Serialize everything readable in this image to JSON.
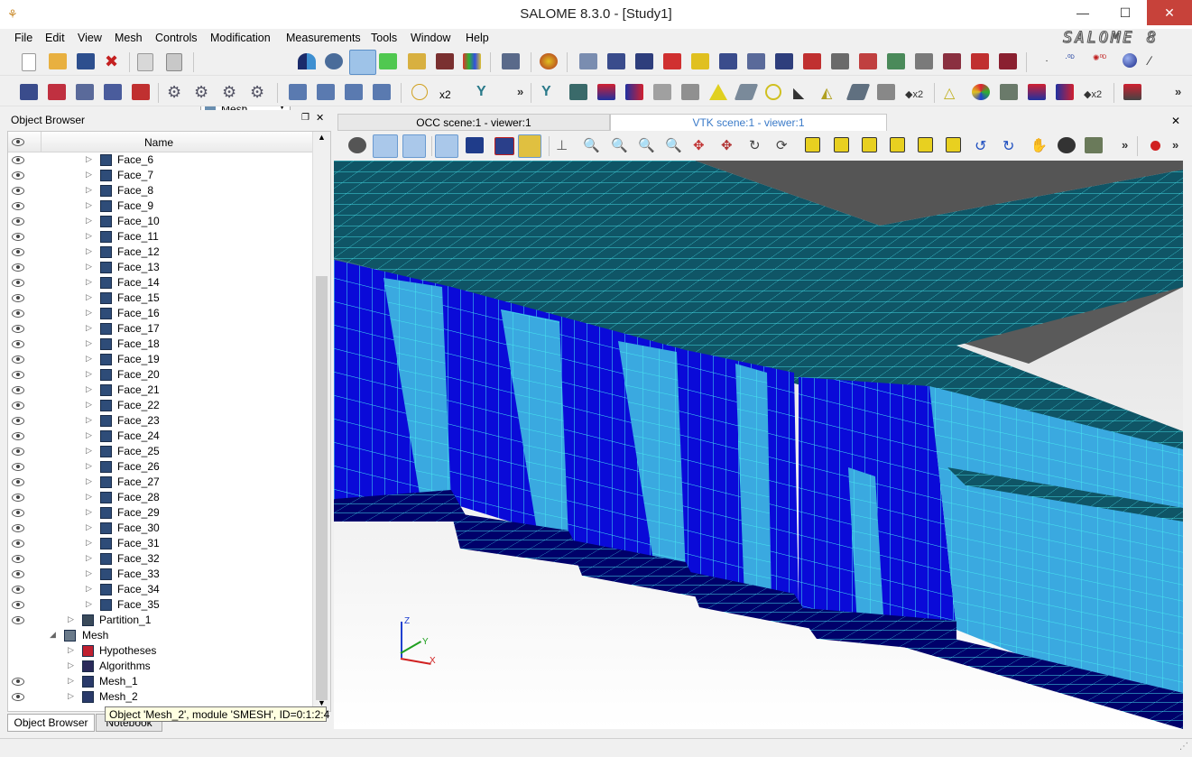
{
  "window": {
    "title": "SALOME 8.3.0 - [Study1]",
    "minimize": "—",
    "maximize": "☐",
    "close": "✕"
  },
  "menu": [
    "File",
    "Edit",
    "View",
    "Mesh",
    "Controls",
    "Modification",
    "Measurements",
    "Tools",
    "Window",
    "Help"
  ],
  "brand": "SALOME 8",
  "toolbar": {
    "module_combo": "Mesh",
    "more_label": "»",
    "x2_label": "x2"
  },
  "object_browser": {
    "title": "Object Browser",
    "column_header": "Name",
    "faces": [
      "Face_6",
      "Face_7",
      "Face_8",
      "Face_9",
      "Face_10",
      "Face_11",
      "Face_12",
      "Face_13",
      "Face_14",
      "Face_15",
      "Face_16",
      "Face_17",
      "Face_18",
      "Face_19",
      "Face_20",
      "Face_21",
      "Face_22",
      "Face_23",
      "Face_24",
      "Face_25",
      "Face_26",
      "Face_27",
      "Face_28",
      "Face_29",
      "Face_30",
      "Face_31",
      "Face_32",
      "Face_33",
      "Face_34",
      "Face_35"
    ],
    "partition": "Partition_1",
    "mesh": "Mesh",
    "hypotheses": "Hypotheses",
    "algorithms": "Algorithms",
    "mesh_1": "Mesh_1",
    "mesh_2": "Mesh_2",
    "tooltip": "Object 'Mesh_2', module 'SMESH', ID=0:1:2:4"
  },
  "bottom_tabs": [
    "Object Browser",
    "Notebook"
  ],
  "viewer_tabs": {
    "occ": "OCC scene:1 - viewer:1",
    "vtk": "VTK scene:1 - viewer:1",
    "close": "✕"
  },
  "axes": {
    "z": "Z",
    "y": "Y",
    "x": "X"
  },
  "colors": {
    "mesh_dark": "#00006a",
    "mesh_blue": "#0a0ad8",
    "mesh_light": "#3aa9e0",
    "mesh_teal": "#0f5566",
    "edge": "#47e6f0",
    "accent": "#3399ff"
  }
}
